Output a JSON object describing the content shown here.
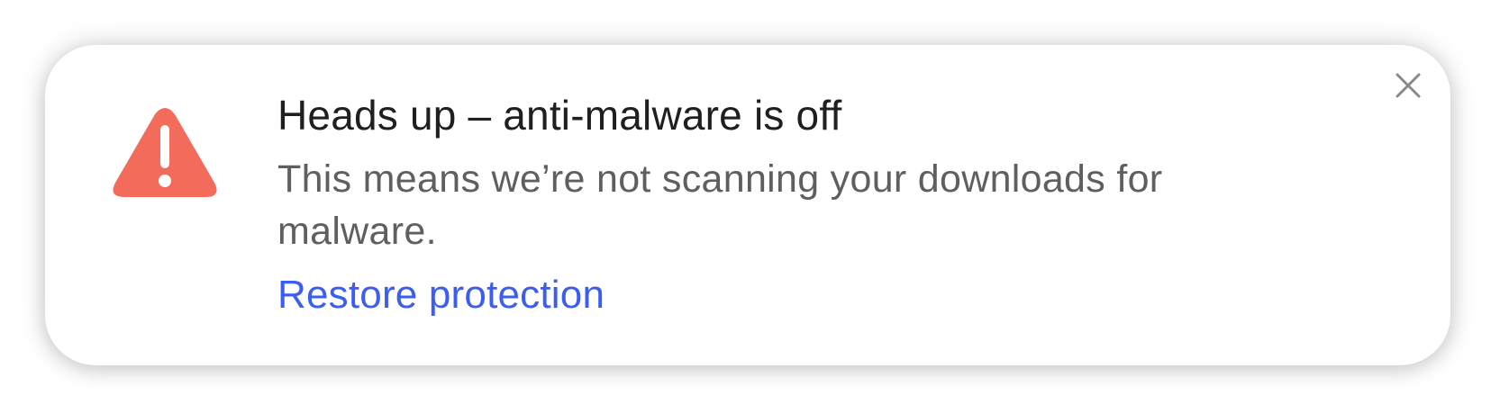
{
  "notification": {
    "title": "Heads up – anti-malware is off",
    "message": "This means we’re not scanning your downloads for malware.",
    "action_label": "Restore protection",
    "warning_icon": "warning-triangle-icon",
    "close_icon": "close-icon"
  },
  "colors": {
    "warning": "#f26b5b",
    "link": "#3b5df0",
    "title": "#1f1f1f",
    "message": "#5f5f5f",
    "close": "#8a8a8a"
  }
}
